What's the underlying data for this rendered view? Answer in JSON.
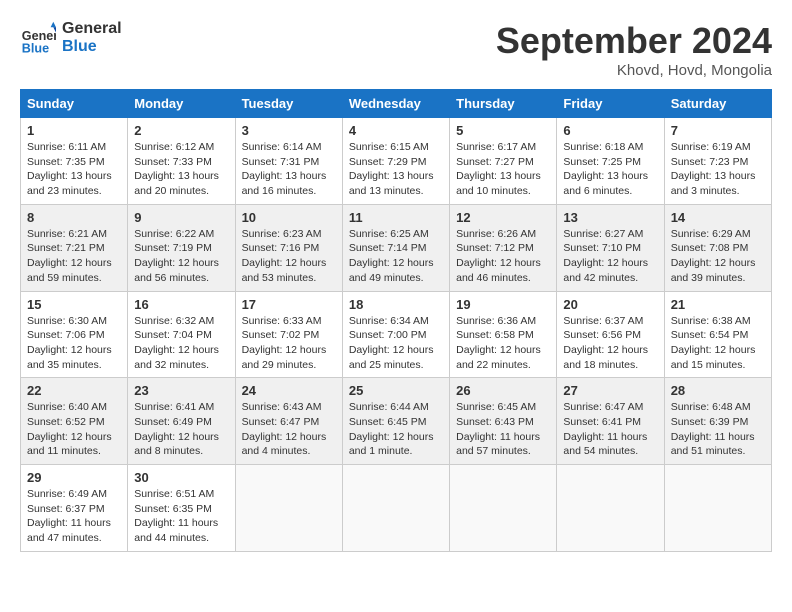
{
  "header": {
    "logo_line1": "General",
    "logo_line2": "Blue",
    "month": "September 2024",
    "location": "Khovd, Hovd, Mongolia"
  },
  "weekdays": [
    "Sunday",
    "Monday",
    "Tuesday",
    "Wednesday",
    "Thursday",
    "Friday",
    "Saturday"
  ],
  "weeks": [
    [
      {
        "day": "1",
        "sunrise": "Sunrise: 6:11 AM",
        "sunset": "Sunset: 7:35 PM",
        "daylight": "Daylight: 13 hours and 23 minutes."
      },
      {
        "day": "2",
        "sunrise": "Sunrise: 6:12 AM",
        "sunset": "Sunset: 7:33 PM",
        "daylight": "Daylight: 13 hours and 20 minutes."
      },
      {
        "day": "3",
        "sunrise": "Sunrise: 6:14 AM",
        "sunset": "Sunset: 7:31 PM",
        "daylight": "Daylight: 13 hours and 16 minutes."
      },
      {
        "day": "4",
        "sunrise": "Sunrise: 6:15 AM",
        "sunset": "Sunset: 7:29 PM",
        "daylight": "Daylight: 13 hours and 13 minutes."
      },
      {
        "day": "5",
        "sunrise": "Sunrise: 6:17 AM",
        "sunset": "Sunset: 7:27 PM",
        "daylight": "Daylight: 13 hours and 10 minutes."
      },
      {
        "day": "6",
        "sunrise": "Sunrise: 6:18 AM",
        "sunset": "Sunset: 7:25 PM",
        "daylight": "Daylight: 13 hours and 6 minutes."
      },
      {
        "day": "7",
        "sunrise": "Sunrise: 6:19 AM",
        "sunset": "Sunset: 7:23 PM",
        "daylight": "Daylight: 13 hours and 3 minutes."
      }
    ],
    [
      {
        "day": "8",
        "sunrise": "Sunrise: 6:21 AM",
        "sunset": "Sunset: 7:21 PM",
        "daylight": "Daylight: 12 hours and 59 minutes."
      },
      {
        "day": "9",
        "sunrise": "Sunrise: 6:22 AM",
        "sunset": "Sunset: 7:19 PM",
        "daylight": "Daylight: 12 hours and 56 minutes."
      },
      {
        "day": "10",
        "sunrise": "Sunrise: 6:23 AM",
        "sunset": "Sunset: 7:16 PM",
        "daylight": "Daylight: 12 hours and 53 minutes."
      },
      {
        "day": "11",
        "sunrise": "Sunrise: 6:25 AM",
        "sunset": "Sunset: 7:14 PM",
        "daylight": "Daylight: 12 hours and 49 minutes."
      },
      {
        "day": "12",
        "sunrise": "Sunrise: 6:26 AM",
        "sunset": "Sunset: 7:12 PM",
        "daylight": "Daylight: 12 hours and 46 minutes."
      },
      {
        "day": "13",
        "sunrise": "Sunrise: 6:27 AM",
        "sunset": "Sunset: 7:10 PM",
        "daylight": "Daylight: 12 hours and 42 minutes."
      },
      {
        "day": "14",
        "sunrise": "Sunrise: 6:29 AM",
        "sunset": "Sunset: 7:08 PM",
        "daylight": "Daylight: 12 hours and 39 minutes."
      }
    ],
    [
      {
        "day": "15",
        "sunrise": "Sunrise: 6:30 AM",
        "sunset": "Sunset: 7:06 PM",
        "daylight": "Daylight: 12 hours and 35 minutes."
      },
      {
        "day": "16",
        "sunrise": "Sunrise: 6:32 AM",
        "sunset": "Sunset: 7:04 PM",
        "daylight": "Daylight: 12 hours and 32 minutes."
      },
      {
        "day": "17",
        "sunrise": "Sunrise: 6:33 AM",
        "sunset": "Sunset: 7:02 PM",
        "daylight": "Daylight: 12 hours and 29 minutes."
      },
      {
        "day": "18",
        "sunrise": "Sunrise: 6:34 AM",
        "sunset": "Sunset: 7:00 PM",
        "daylight": "Daylight: 12 hours and 25 minutes."
      },
      {
        "day": "19",
        "sunrise": "Sunrise: 6:36 AM",
        "sunset": "Sunset: 6:58 PM",
        "daylight": "Daylight: 12 hours and 22 minutes."
      },
      {
        "day": "20",
        "sunrise": "Sunrise: 6:37 AM",
        "sunset": "Sunset: 6:56 PM",
        "daylight": "Daylight: 12 hours and 18 minutes."
      },
      {
        "day": "21",
        "sunrise": "Sunrise: 6:38 AM",
        "sunset": "Sunset: 6:54 PM",
        "daylight": "Daylight: 12 hours and 15 minutes."
      }
    ],
    [
      {
        "day": "22",
        "sunrise": "Sunrise: 6:40 AM",
        "sunset": "Sunset: 6:52 PM",
        "daylight": "Daylight: 12 hours and 11 minutes."
      },
      {
        "day": "23",
        "sunrise": "Sunrise: 6:41 AM",
        "sunset": "Sunset: 6:49 PM",
        "daylight": "Daylight: 12 hours and 8 minutes."
      },
      {
        "day": "24",
        "sunrise": "Sunrise: 6:43 AM",
        "sunset": "Sunset: 6:47 PM",
        "daylight": "Daylight: 12 hours and 4 minutes."
      },
      {
        "day": "25",
        "sunrise": "Sunrise: 6:44 AM",
        "sunset": "Sunset: 6:45 PM",
        "daylight": "Daylight: 12 hours and 1 minute."
      },
      {
        "day": "26",
        "sunrise": "Sunrise: 6:45 AM",
        "sunset": "Sunset: 6:43 PM",
        "daylight": "Daylight: 11 hours and 57 minutes."
      },
      {
        "day": "27",
        "sunrise": "Sunrise: 6:47 AM",
        "sunset": "Sunset: 6:41 PM",
        "daylight": "Daylight: 11 hours and 54 minutes."
      },
      {
        "day": "28",
        "sunrise": "Sunrise: 6:48 AM",
        "sunset": "Sunset: 6:39 PM",
        "daylight": "Daylight: 11 hours and 51 minutes."
      }
    ],
    [
      {
        "day": "29",
        "sunrise": "Sunrise: 6:49 AM",
        "sunset": "Sunset: 6:37 PM",
        "daylight": "Daylight: 11 hours and 47 minutes."
      },
      {
        "day": "30",
        "sunrise": "Sunrise: 6:51 AM",
        "sunset": "Sunset: 6:35 PM",
        "daylight": "Daylight: 11 hours and 44 minutes."
      },
      null,
      null,
      null,
      null,
      null
    ]
  ]
}
